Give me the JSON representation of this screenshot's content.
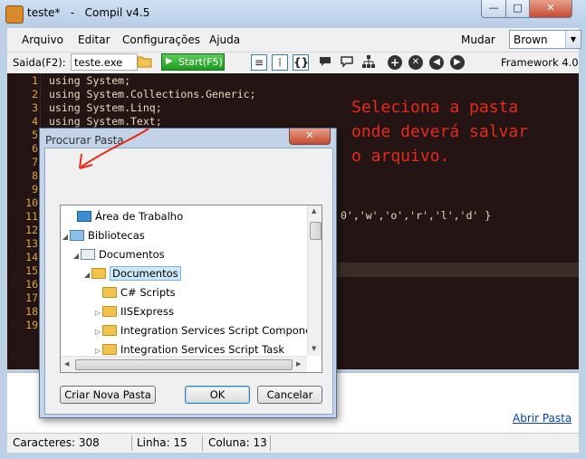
{
  "window": {
    "title": "teste*   -   Compil v4.5",
    "minimize": "—",
    "maximize": "□",
    "close": "✕"
  },
  "menu": {
    "items": [
      "Arquivo",
      "Editar",
      "Configurações",
      "Ajuda"
    ],
    "mudar_label": "Mudar",
    "theme_value": "Brown"
  },
  "toolbar": {
    "saida_label": "Saida(F2):",
    "saida_value": "teste.exe",
    "start_label": "Start(F5)",
    "framework_label": "Framework 4.0"
  },
  "editor": {
    "line_numbers": [
      "1",
      "2",
      "3",
      "4",
      "5",
      "6",
      "7",
      "8",
      "9",
      "10",
      "11",
      "12",
      "13",
      "14",
      "15",
      "16",
      "17",
      "18",
      "19"
    ],
    "code_lines": [
      "using System;",
      "using System.Collections.Generic;",
      "using System.Linq;",
      "using System.Text;"
    ],
    "code_tail": "0','w','o','r','l','d' }",
    "current_line": 15,
    "annotation_lines": [
      "Seleciona a pasta",
      "onde deverá salvar",
      "o arquivo."
    ],
    "annotation_color": "#e82a1b",
    "background_color": "#241514",
    "line_number_color": "#e0a94a"
  },
  "output": {
    "abrir_pasta": "Abrir Pasta"
  },
  "status": {
    "caracteres": "Caracteres: 308",
    "linha": "Linha: 15",
    "coluna": "Coluna: 13"
  },
  "dialog": {
    "title": "Procurar Pasta",
    "close": "✕",
    "tree": [
      {
        "label": "Área de Trabalho",
        "icon": "desktop-icon",
        "expander": ""
      },
      {
        "label": "Bibliotecas",
        "icon": "libraries-icon",
        "expander": "◢"
      },
      {
        "label": "Documentos",
        "icon": "documents-library-icon",
        "expander": "◢"
      },
      {
        "label": "Documentos",
        "icon": "folder-icon",
        "expander": "◢",
        "selected": true
      },
      {
        "label": "C# Scripts",
        "icon": "folder-icon",
        "expander": ""
      },
      {
        "label": "IISExpress",
        "icon": "folder-icon",
        "expander": "▷"
      },
      {
        "label": "Integration Services Script Componen",
        "icon": "folder-icon",
        "expander": "▷"
      },
      {
        "label": "Integration Services Script Task",
        "icon": "folder-icon",
        "expander": "▷"
      }
    ],
    "buttons": {
      "new_folder": "Criar Nova Pasta",
      "ok": "OK",
      "cancel": "Cancelar"
    }
  }
}
